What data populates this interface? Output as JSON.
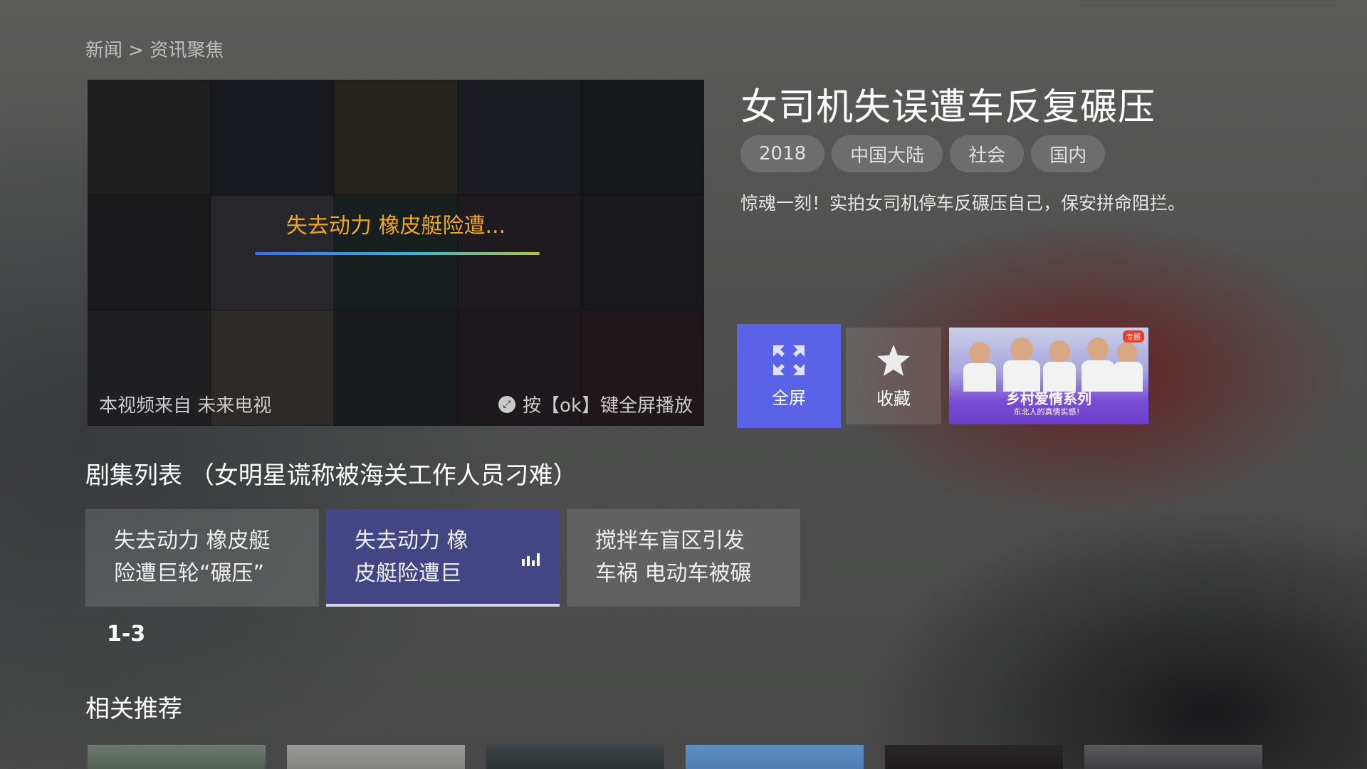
{
  "breadcrumb": "新闻 > 资讯聚焦",
  "player": {
    "now_playing": "失去动力 橡皮艇险遭...",
    "source": "本视频来自 未来电视",
    "hint": "按【ok】键全屏播放"
  },
  "video": {
    "title": "女司机失误遭车反复碾压",
    "tags": [
      "2018",
      "中国大陆",
      "社会",
      "国内"
    ],
    "description": "惊魂一刻！实拍女司机停车反碾压自己，保安拼命阻拦。"
  },
  "actions": {
    "fullscreen_label": "全屏",
    "favorite_label": "收藏"
  },
  "banner": {
    "title": "乡村爱情系列",
    "subtitle": "东北人的真情实感！",
    "badge": "专题"
  },
  "episode_list": {
    "title": "剧集列表 （女明星谎称被海关工作人员刁难）",
    "items": [
      {
        "line1": "失去动力 橡皮艇",
        "line2": "险遭巨轮“碾压”"
      },
      {
        "line1": "失去动力 橡",
        "line2": "皮艇险遭巨"
      },
      {
        "line1": "搅拌车盲区引发",
        "line2": "车祸 电动车被碾"
      }
    ],
    "active_index": 1,
    "range": "1-3"
  },
  "recommendations": {
    "title": "相关推荐"
  },
  "colors": {
    "accent": "#5a63e8",
    "active_episode": "#434585",
    "progress_orange": "#f0a623"
  },
  "icons": {
    "fullscreen": "expand-arrows-icon",
    "favorite": "star-icon",
    "playing": "equalizer-icon",
    "hint": "remote-ok-icon"
  }
}
